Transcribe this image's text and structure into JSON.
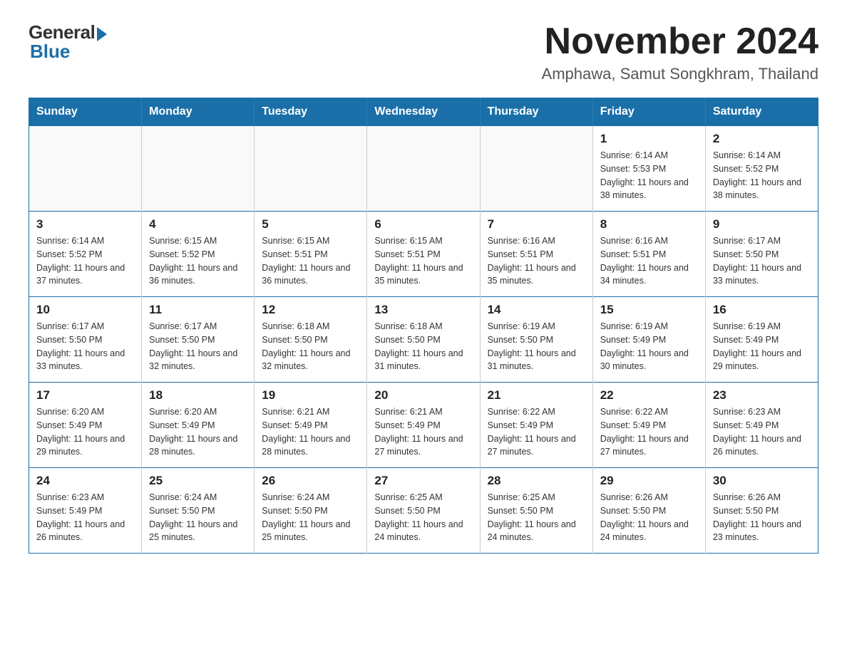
{
  "logo": {
    "general": "General",
    "blue": "Blue"
  },
  "title": "November 2024",
  "subtitle": "Amphawa, Samut Songkhram, Thailand",
  "weekdays": [
    "Sunday",
    "Monday",
    "Tuesday",
    "Wednesday",
    "Thursday",
    "Friday",
    "Saturday"
  ],
  "weeks": [
    [
      {
        "day": "",
        "info": ""
      },
      {
        "day": "",
        "info": ""
      },
      {
        "day": "",
        "info": ""
      },
      {
        "day": "",
        "info": ""
      },
      {
        "day": "",
        "info": ""
      },
      {
        "day": "1",
        "info": "Sunrise: 6:14 AM\nSunset: 5:53 PM\nDaylight: 11 hours and 38 minutes."
      },
      {
        "day": "2",
        "info": "Sunrise: 6:14 AM\nSunset: 5:52 PM\nDaylight: 11 hours and 38 minutes."
      }
    ],
    [
      {
        "day": "3",
        "info": "Sunrise: 6:14 AM\nSunset: 5:52 PM\nDaylight: 11 hours and 37 minutes."
      },
      {
        "day": "4",
        "info": "Sunrise: 6:15 AM\nSunset: 5:52 PM\nDaylight: 11 hours and 36 minutes."
      },
      {
        "day": "5",
        "info": "Sunrise: 6:15 AM\nSunset: 5:51 PM\nDaylight: 11 hours and 36 minutes."
      },
      {
        "day": "6",
        "info": "Sunrise: 6:15 AM\nSunset: 5:51 PM\nDaylight: 11 hours and 35 minutes."
      },
      {
        "day": "7",
        "info": "Sunrise: 6:16 AM\nSunset: 5:51 PM\nDaylight: 11 hours and 35 minutes."
      },
      {
        "day": "8",
        "info": "Sunrise: 6:16 AM\nSunset: 5:51 PM\nDaylight: 11 hours and 34 minutes."
      },
      {
        "day": "9",
        "info": "Sunrise: 6:17 AM\nSunset: 5:50 PM\nDaylight: 11 hours and 33 minutes."
      }
    ],
    [
      {
        "day": "10",
        "info": "Sunrise: 6:17 AM\nSunset: 5:50 PM\nDaylight: 11 hours and 33 minutes."
      },
      {
        "day": "11",
        "info": "Sunrise: 6:17 AM\nSunset: 5:50 PM\nDaylight: 11 hours and 32 minutes."
      },
      {
        "day": "12",
        "info": "Sunrise: 6:18 AM\nSunset: 5:50 PM\nDaylight: 11 hours and 32 minutes."
      },
      {
        "day": "13",
        "info": "Sunrise: 6:18 AM\nSunset: 5:50 PM\nDaylight: 11 hours and 31 minutes."
      },
      {
        "day": "14",
        "info": "Sunrise: 6:19 AM\nSunset: 5:50 PM\nDaylight: 11 hours and 31 minutes."
      },
      {
        "day": "15",
        "info": "Sunrise: 6:19 AM\nSunset: 5:49 PM\nDaylight: 11 hours and 30 minutes."
      },
      {
        "day": "16",
        "info": "Sunrise: 6:19 AM\nSunset: 5:49 PM\nDaylight: 11 hours and 29 minutes."
      }
    ],
    [
      {
        "day": "17",
        "info": "Sunrise: 6:20 AM\nSunset: 5:49 PM\nDaylight: 11 hours and 29 minutes."
      },
      {
        "day": "18",
        "info": "Sunrise: 6:20 AM\nSunset: 5:49 PM\nDaylight: 11 hours and 28 minutes."
      },
      {
        "day": "19",
        "info": "Sunrise: 6:21 AM\nSunset: 5:49 PM\nDaylight: 11 hours and 28 minutes."
      },
      {
        "day": "20",
        "info": "Sunrise: 6:21 AM\nSunset: 5:49 PM\nDaylight: 11 hours and 27 minutes."
      },
      {
        "day": "21",
        "info": "Sunrise: 6:22 AM\nSunset: 5:49 PM\nDaylight: 11 hours and 27 minutes."
      },
      {
        "day": "22",
        "info": "Sunrise: 6:22 AM\nSunset: 5:49 PM\nDaylight: 11 hours and 27 minutes."
      },
      {
        "day": "23",
        "info": "Sunrise: 6:23 AM\nSunset: 5:49 PM\nDaylight: 11 hours and 26 minutes."
      }
    ],
    [
      {
        "day": "24",
        "info": "Sunrise: 6:23 AM\nSunset: 5:49 PM\nDaylight: 11 hours and 26 minutes."
      },
      {
        "day": "25",
        "info": "Sunrise: 6:24 AM\nSunset: 5:50 PM\nDaylight: 11 hours and 25 minutes."
      },
      {
        "day": "26",
        "info": "Sunrise: 6:24 AM\nSunset: 5:50 PM\nDaylight: 11 hours and 25 minutes."
      },
      {
        "day": "27",
        "info": "Sunrise: 6:25 AM\nSunset: 5:50 PM\nDaylight: 11 hours and 24 minutes."
      },
      {
        "day": "28",
        "info": "Sunrise: 6:25 AM\nSunset: 5:50 PM\nDaylight: 11 hours and 24 minutes."
      },
      {
        "day": "29",
        "info": "Sunrise: 6:26 AM\nSunset: 5:50 PM\nDaylight: 11 hours and 24 minutes."
      },
      {
        "day": "30",
        "info": "Sunrise: 6:26 AM\nSunset: 5:50 PM\nDaylight: 11 hours and 23 minutes."
      }
    ]
  ]
}
